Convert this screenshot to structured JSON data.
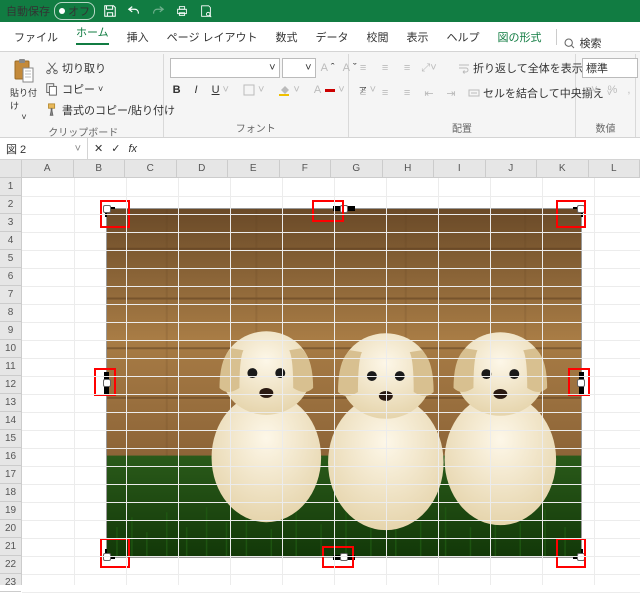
{
  "titlebar": {
    "autosave_label": "自動保存",
    "autosave_state": "オフ"
  },
  "tabs": {
    "file": "ファイル",
    "home": "ホーム",
    "insert": "挿入",
    "layout": "ページ レイアウト",
    "formula": "数式",
    "data": "データ",
    "review": "校閲",
    "view": "表示",
    "help": "ヘルプ",
    "picformat": "図の形式",
    "search": "検索"
  },
  "clipboard": {
    "paste": "貼り付け",
    "cut": "切り取り",
    "copy": "コピー",
    "formatpainter": "書式のコピー/貼り付け",
    "group": "クリップボード"
  },
  "font": {
    "group": "フォント"
  },
  "align": {
    "wrap": "折り返して全体を表示する",
    "merge": "セルを結合して中央揃え",
    "group": "配置"
  },
  "number": {
    "style": "標準",
    "group": "数値"
  },
  "namebox": "図 2",
  "cols": [
    "A",
    "B",
    "C",
    "D",
    "E",
    "F",
    "G",
    "H",
    "I",
    "J",
    "K",
    "L"
  ],
  "rows": [
    "1",
    "2",
    "3",
    "4",
    "5",
    "6",
    "7",
    "8",
    "9",
    "10",
    "11",
    "12",
    "13",
    "14",
    "15",
    "16",
    "17",
    "18",
    "19",
    "20",
    "21",
    "22",
    "23"
  ],
  "symbols": {
    "percent": "%",
    "comma": ","
  }
}
